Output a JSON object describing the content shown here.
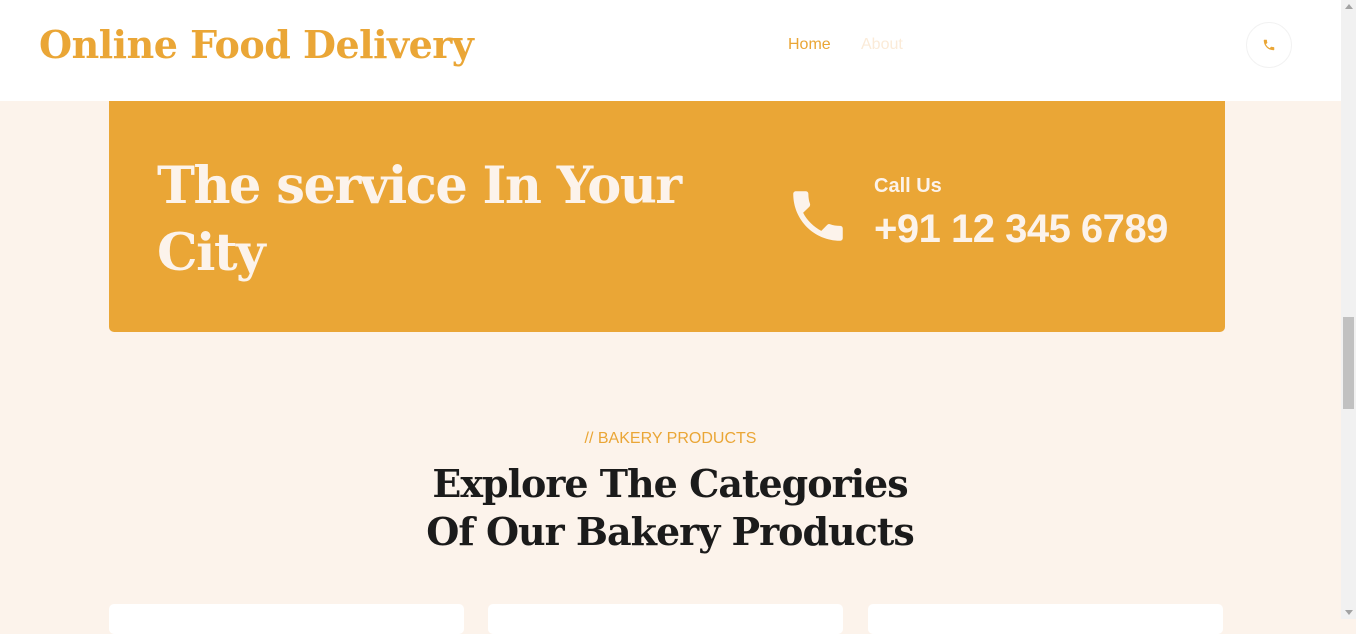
{
  "header": {
    "brand": "Online Food Delivery",
    "nav": [
      {
        "label": "Home",
        "active": true
      },
      {
        "label": "About",
        "active": false
      }
    ],
    "call_icon": "phone-icon"
  },
  "banner": {
    "title": "The service In Your City",
    "call_label": "Call Us",
    "phone_number": "+91 12 345 6789",
    "icon": "phone-icon"
  },
  "section": {
    "eyebrow": "// BAKERY PRODUCTS",
    "title": "Explore The Categories Of Our Bakery Products"
  },
  "cards": [
    {},
    {},
    {}
  ],
  "colors": {
    "accent": "#EAA636",
    "page_background": "#FCF3EB",
    "heading": "#1B1B1B"
  }
}
